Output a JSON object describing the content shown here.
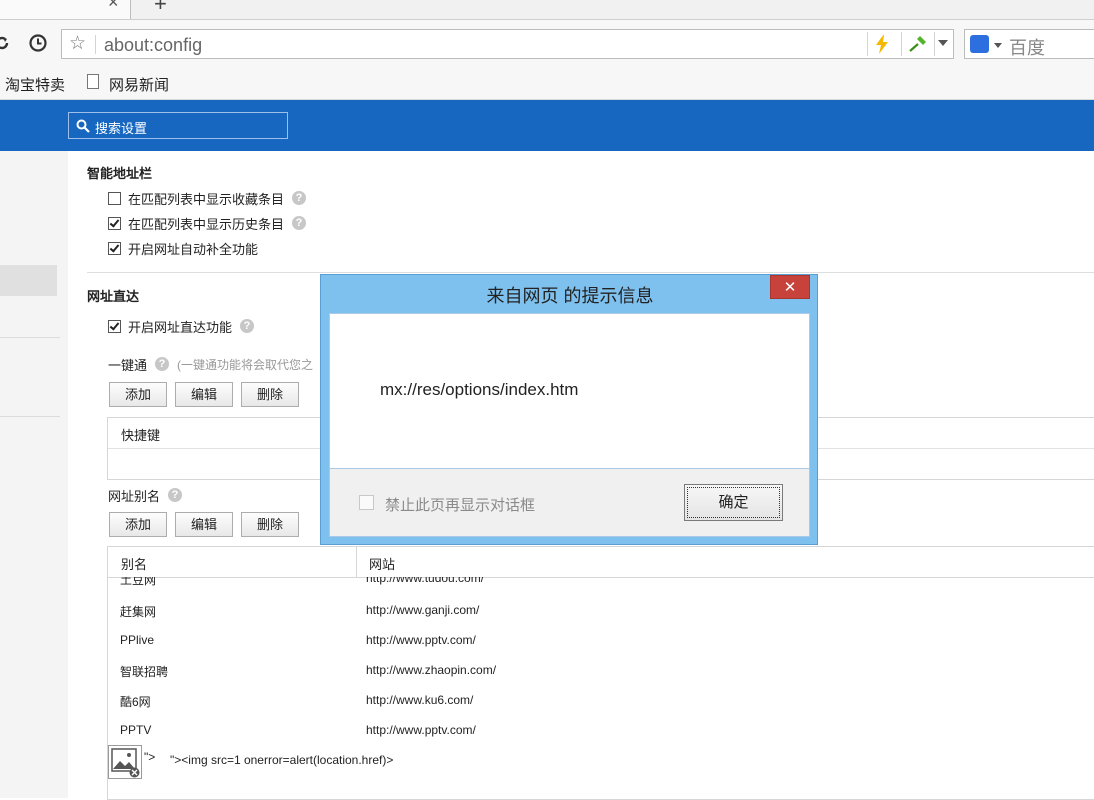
{
  "tabs": {
    "close": "×",
    "new": "+"
  },
  "toolbar": {
    "address": "about:config",
    "search_placeholder": "百度"
  },
  "bookmarks": [
    "淘宝特卖",
    "网易新闻"
  ],
  "header": {
    "search_placeholder": "搜索设置"
  },
  "smart_bar": {
    "title": "智能地址栏",
    "options": [
      {
        "label": "在匹配列表中显示收藏条目",
        "checked": false,
        "help": "?"
      },
      {
        "label": "在匹配列表中显示历史条目",
        "checked": true,
        "help": "?"
      },
      {
        "label": "开启网址自动补全功能",
        "checked": true,
        "help": ""
      }
    ]
  },
  "direct": {
    "title": "网址直达",
    "enable_label": "开启网址直达功能",
    "help": "?",
    "onekey_label": "一键通",
    "onekey_note": "(一键通功能将会取代您之",
    "buttons": {
      "add": "添加",
      "edit": "编辑",
      "delete": "删除"
    },
    "onekey_table_header": "快捷键",
    "alias_label": "网址别名",
    "alias_table": {
      "col_alias": "别名",
      "col_site": "网站",
      "rows": [
        {
          "alias": "土豆网",
          "site": "http://www.tudou.com/"
        },
        {
          "alias": "赶集网",
          "site": "http://www.ganji.com/"
        },
        {
          "alias": "PPlive",
          "site": "http://www.pptv.com/"
        },
        {
          "alias": "智联招聘",
          "site": "http://www.zhaopin.com/"
        },
        {
          "alias": "酷6网",
          "site": "http://www.ku6.com/"
        },
        {
          "alias": "PPTV",
          "site": "http://www.pptv.com/"
        }
      ],
      "injected_alias": "\">",
      "injected_site": "\"><img src=1 onerror=alert(location.href)>"
    }
  },
  "dialog": {
    "title": "来自网页  的提示信息",
    "close": "✕",
    "message": "mx://res/options/index.htm",
    "suppress_label": "禁止此页再显示对话框",
    "ok": "确定"
  }
}
